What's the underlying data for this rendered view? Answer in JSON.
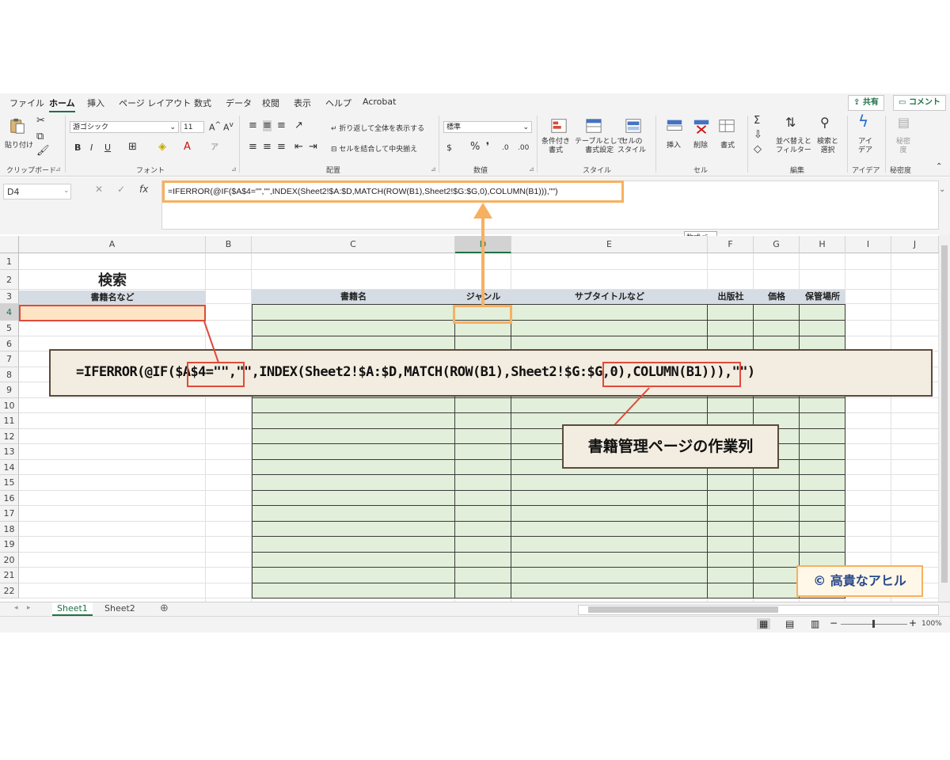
{
  "ribbon_tabs": [
    "ファイル",
    "ホーム",
    "挿入",
    "ページ レイアウト",
    "数式",
    "データ",
    "校閲",
    "表示",
    "ヘルプ",
    "Acrobat"
  ],
  "top_buttons": {
    "share": "共有",
    "comment": "コメント"
  },
  "ribbon": {
    "clipboard": {
      "paste": "貼り付け",
      "label": "クリップボード"
    },
    "font": {
      "name": "游ゴシック",
      "size": "11",
      "bold": "B",
      "italic": "I",
      "underline": "U",
      "label": "フォント"
    },
    "alignment": {
      "wrap": "折り返して全体を表示する",
      "merge": "セルを結合して中央揃え",
      "label": "配置"
    },
    "number": {
      "format": "標準",
      "percent": "%",
      "label": "数値"
    },
    "styles": {
      "conditional": "条件付き\n書式",
      "table": "テーブルとして\n書式設定",
      "cell": "セルの\nスタイル",
      "label": "スタイル"
    },
    "cells": {
      "insert": "挿入",
      "delete": "削除",
      "format": "書式",
      "label": "セル"
    },
    "editing": {
      "sort": "並べ替えと\nフィルター",
      "find": "検索と\n選択",
      "label": "編集"
    },
    "ideas": {
      "button": "アイ\nデア",
      "label": "アイデア"
    },
    "sensitivity": {
      "button": "秘密\n度",
      "label": "秘密度"
    }
  },
  "formula_bar": {
    "name_box": "D4",
    "fx": "fx",
    "formula": "=IFERROR(@IF($A$4=\"\",\"\",INDEX(Sheet2!$A:$D,MATCH(ROW(B1),Sheet2!$G:$G,0),COLUMN(B1))),\"\")",
    "tooltip": "数式バー"
  },
  "columns": [
    "A",
    "B",
    "C",
    "D",
    "E",
    "F",
    "G",
    "H",
    "I",
    "J"
  ],
  "rows": [
    "1",
    "2",
    "3",
    "4",
    "5",
    "6",
    "7",
    "8",
    "9",
    "10",
    "11",
    "12",
    "13",
    "14",
    "15",
    "16",
    "17",
    "18",
    "19",
    "20",
    "21",
    "22"
  ],
  "cells": {
    "search_title": "検索",
    "search_label": "書籍名など",
    "headers": [
      "書籍名",
      "ジャンル",
      "サブタイトルなど",
      "出版社",
      "価格",
      "保管場所"
    ]
  },
  "sheets": [
    "Sheet1",
    "Sheet2"
  ],
  "status": {
    "zoom": "100%"
  },
  "annotations": {
    "formula_text": "=IFERROR(@IF($A$4=\"\",\"\",INDEX(Sheet2!$A:$D,MATCH(ROW(B1),Sheet2!$G:$G,0),COLUMN(B1))),\"\")",
    "work_column": "書籍管理ページの作業列",
    "copyright": "© 高貴なアヒル"
  },
  "colors": {
    "accent": "#1e7145",
    "table_fill": "#e2efda",
    "header_fill": "#d6dce4",
    "highlight_orange": "#f7b060",
    "highlight_red": "#e04a3a"
  }
}
